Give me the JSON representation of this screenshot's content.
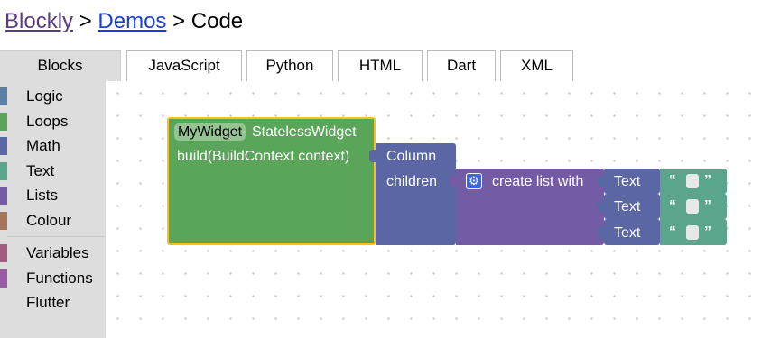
{
  "breadcrumb": {
    "link1": "Blockly",
    "sep1": ">",
    "link2": "Demos",
    "sep2": ">",
    "current": "Code"
  },
  "toolbox": {
    "header": "Blocks",
    "categories": [
      {
        "label": "Logic",
        "color": "#5b80a5"
      },
      {
        "label": "Loops",
        "color": "#5ba55b"
      },
      {
        "label": "Math",
        "color": "#5b67a5"
      },
      {
        "label": "Text",
        "color": "#5ba58c"
      },
      {
        "label": "Lists",
        "color": "#745ba5"
      },
      {
        "label": "Colour",
        "color": "#a5745b"
      },
      {
        "label": "Variables",
        "color": "#a55b80"
      },
      {
        "label": "Functions",
        "color": "#995ba5"
      },
      {
        "label": "Flutter",
        "color": "#dddddd"
      }
    ]
  },
  "tabs": [
    "JavaScript",
    "Python",
    "HTML",
    "Dart",
    "XML"
  ],
  "blocks": {
    "widget": {
      "name": "MyWidget",
      "type_label": "StatelessWidget",
      "build_label": "build(BuildContext context)",
      "color": "#5ba55b"
    },
    "column": {
      "label": "Column",
      "children_label": "children",
      "color": "#5b67a5"
    },
    "list": {
      "label": "create list with",
      "mutator_icon": "gear-icon",
      "color": "#745ba5"
    },
    "text_items": [
      {
        "label": "Text",
        "open_quote": "“",
        "close_quote": "”"
      },
      {
        "label": "Text",
        "open_quote": "“",
        "close_quote": "”"
      },
      {
        "label": "Text",
        "open_quote": "“",
        "close_quote": "”"
      }
    ],
    "text_color": "#5b67a5",
    "string_color": "#5ba58c"
  }
}
